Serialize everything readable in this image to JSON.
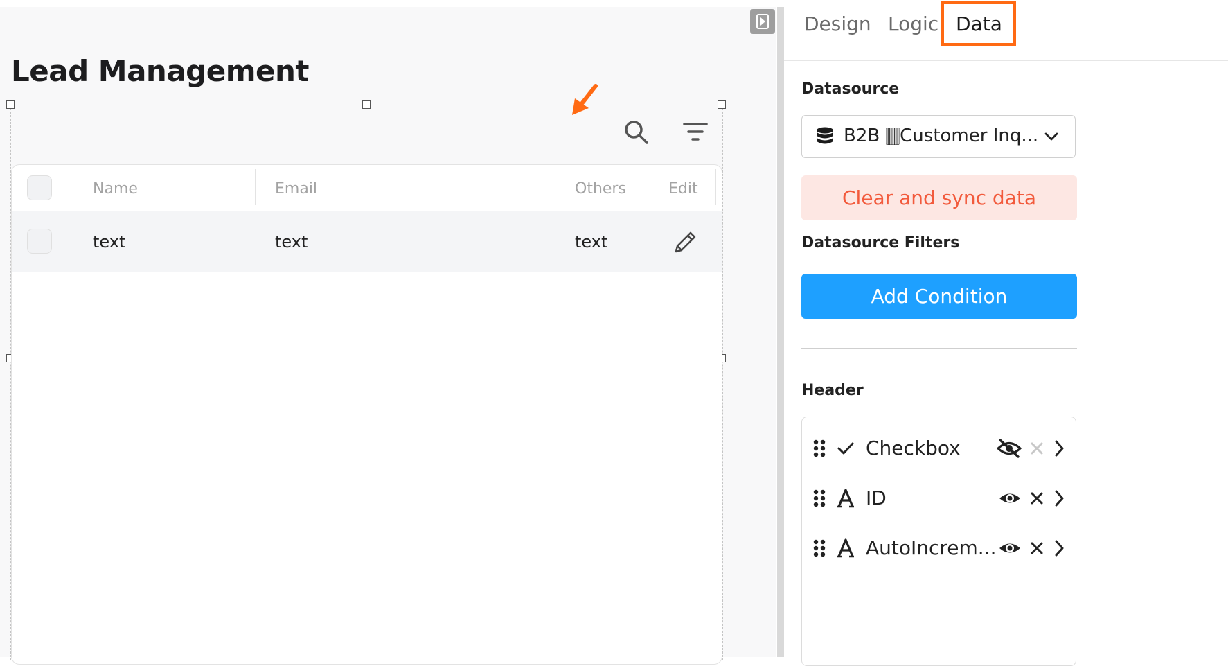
{
  "canvas": {
    "page_title": "Lead Management"
  },
  "table": {
    "columns": [
      "Name",
      "Email",
      "Others",
      "Edit"
    ],
    "rows": [
      {
        "name": "text",
        "email": "text",
        "others": "text"
      }
    ]
  },
  "panel": {
    "tabs": [
      {
        "label": "Design",
        "active": false
      },
      {
        "label": "Logic",
        "active": false
      },
      {
        "label": "Data",
        "active": true
      }
    ],
    "datasource_label": "Datasource",
    "datasource_value": "B2B 🀫Customer Inq...",
    "clear_sync_label": "Clear and sync data",
    "filters_label": "Datasource Filters",
    "add_condition_label": "Add Condition",
    "header_label": "Header",
    "header_fields": [
      {
        "label": "Checkbox",
        "type_icon": "check-icon",
        "visible": false,
        "removable": false
      },
      {
        "label": "ID",
        "type_icon": "text-type-icon",
        "visible": true,
        "removable": true
      },
      {
        "label": "AutoIncrem...",
        "type_icon": "text-type-icon",
        "visible": true,
        "removable": true
      }
    ]
  },
  "colors": {
    "highlight": "#ff6a13",
    "primary": "#1ea0ff",
    "danger_text": "#f25a3c",
    "danger_bg": "#fde7e3"
  }
}
